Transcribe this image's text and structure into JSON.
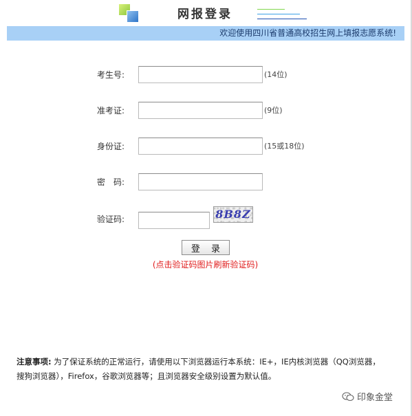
{
  "header": {
    "title": "网报登录",
    "logo_icon": "colored-squares-logo",
    "accent_blue": "#a8d0f6"
  },
  "banner": {
    "text": "欢迎使用四川省普通高校招生网上填报志愿系统!"
  },
  "form": {
    "exam_no": {
      "label": "考生号:",
      "hint": "(14位)",
      "value": ""
    },
    "admission_no": {
      "label": "准考证:",
      "hint": "(9位)",
      "value": ""
    },
    "id_card": {
      "label": "身份证:",
      "hint": "(15或18位)",
      "value": ""
    },
    "password": {
      "label": "密　码:",
      "value": ""
    },
    "captcha": {
      "label": "验证码:",
      "value": "",
      "image_text": "8B8Z"
    },
    "login_label": "登 录",
    "refresh_tip": "(点击验证码图片刷新验证码)",
    "tip_color": "#e01b1b"
  },
  "notes": {
    "title": "注意事项:",
    "body": "为了保证系统的正常运行，请使用以下浏览器运行本系统：IE+，IE内核浏览器（QQ浏览器，搜狗浏览器），Firefox，谷歌浏览器等；且浏览器安全级别设置为默认值。"
  },
  "watermark": {
    "icon": "wechat-icon",
    "text": "印象金堂"
  }
}
